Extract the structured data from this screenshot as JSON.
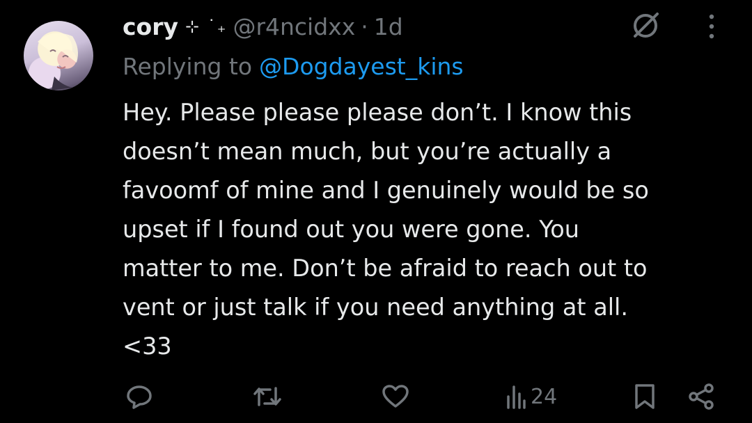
{
  "tweet": {
    "display_name": "cory",
    "name_decoration": "⊹ ˙₊",
    "handle": "@r4ncidxx",
    "separator": "·",
    "time": "1d",
    "replying_prefix": "Replying to",
    "replying_to": "@Dogdayest_kins",
    "text": "Hey. Please please please don’t. I know this\ndoesn’t mean much, but you’re actually a\nfavoomf of mine and I genuinely would be so\nupset if I found out you were gone. You\nmatter to me. Don’t be afraid to reach out to\nvent or just talk if you need anything at all.\n<33"
  },
  "actions": {
    "views_count": "24"
  },
  "icons": [
    "grok-icon",
    "more-icon",
    "reply-icon",
    "repost-icon",
    "like-icon",
    "views-icon",
    "bookmark-icon",
    "share-icon"
  ],
  "colors": {
    "background": "#000000",
    "text": "#e7e9ea",
    "muted": "#71767b",
    "accent": "#1d9bf0"
  }
}
